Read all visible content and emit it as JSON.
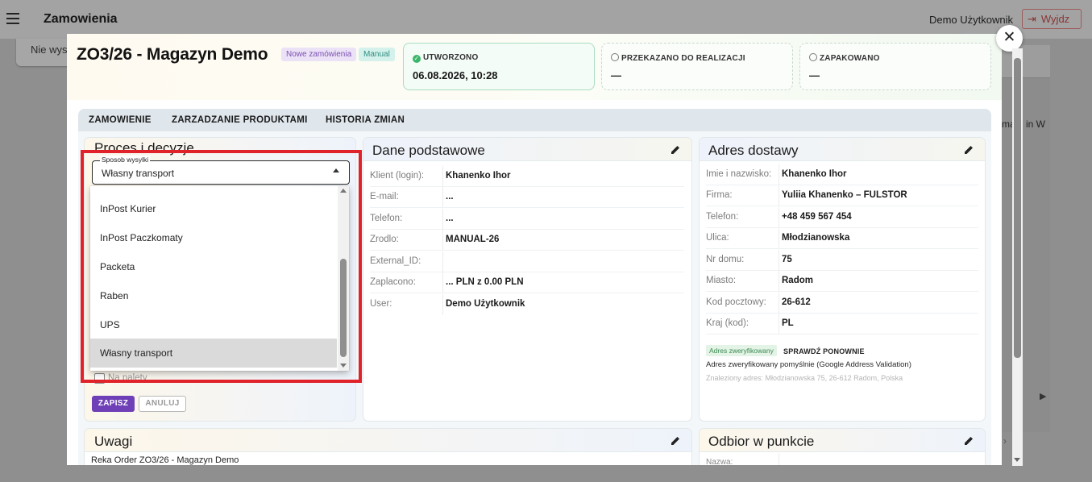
{
  "appbar": {
    "title": "Zamowienia",
    "user": "Demo Użytkownik",
    "logout_label": "Wyjdz"
  },
  "background": {
    "card_text": "Nie wysy",
    "text_w": "ma  d in W"
  },
  "order": {
    "title": "ZO3/26 - Magazyn Demo",
    "status_badge": "Nowe zamówienia",
    "type_badge": "Manual",
    "steps": [
      {
        "label": "UTWORZONO",
        "value": "06.08.2026, 10:28",
        "done": true
      },
      {
        "label": "PRZEKAZANO DO REALIZACJI",
        "value": "—",
        "done": false
      },
      {
        "label": "ZAPAKOWANO",
        "value": "—",
        "done": false
      }
    ]
  },
  "tabs": [
    "ZAMOWIENIE",
    "ZARZADZANIE PRODUKTAMI",
    "HISTORIA ZMIAN"
  ],
  "proces": {
    "title": "Proces i decyzje",
    "shipping_label": "Sposob wysylki",
    "shipping_value": "Własny transport",
    "options": [
      "InPost Kurier",
      "InPost Paczkomaty",
      "Packeta",
      "Raben",
      "UPS",
      "Własny transport"
    ],
    "selected_option": "Własny transport",
    "checkbox_label": "Na palety",
    "save_label": "ZAPISZ",
    "cancel_label": "ANULUJ"
  },
  "dane": {
    "title": "Dane podstawowe",
    "rows": [
      {
        "k": "Klient (login):",
        "v": "Khanenko Ihor"
      },
      {
        "k": "E-mail:",
        "v": "..."
      },
      {
        "k": "Telefon:",
        "v": "..."
      },
      {
        "k": "Zrodlo:",
        "v": "MANUAL-26"
      },
      {
        "k": "External_ID:",
        "v": ""
      },
      {
        "k": "Zaplacono:",
        "v": "... PLN z 0.00 PLN"
      },
      {
        "k": "User:",
        "v": "Demo Użytkownik"
      }
    ]
  },
  "adres": {
    "title": "Adres dostawy",
    "rows": [
      {
        "k": "Imie i nazwisko:",
        "v": "Khanenko Ihor"
      },
      {
        "k": "Firma:",
        "v": "Yuliia Khanenko – FULSTOR"
      },
      {
        "k": "Telefon:",
        "v": "+48 459 567 454"
      },
      {
        "k": "Ulica:",
        "v": "Młodzianowska"
      },
      {
        "k": "Nr domu:",
        "v": "75"
      },
      {
        "k": "Miasto:",
        "v": "Radom"
      },
      {
        "k": "Kod pocztowy:",
        "v": "26-612"
      },
      {
        "k": "Kraj (kod):",
        "v": "PL"
      }
    ],
    "verified_badge": "Adres zweryfikowany",
    "recheck_label": "SPRAWDŹ PONOWNIE",
    "verify_text": "Adres zweryfikowany pomyślnie (Google Address Validation)",
    "found_address": "Znaleziony adres: Młodzianowska 75, 26-612 Radom, Polska"
  },
  "uwagi": {
    "title": "Uwagi",
    "text": "Reka Order ZO3/26 - Magazyn Demo"
  },
  "odbior": {
    "title": "Odbior w punkcie",
    "first_label": "Nazwa:"
  },
  "colors": {
    "primary": "#6e3fb6",
    "highlight": "#e0222a",
    "done": "#3ab66a"
  }
}
